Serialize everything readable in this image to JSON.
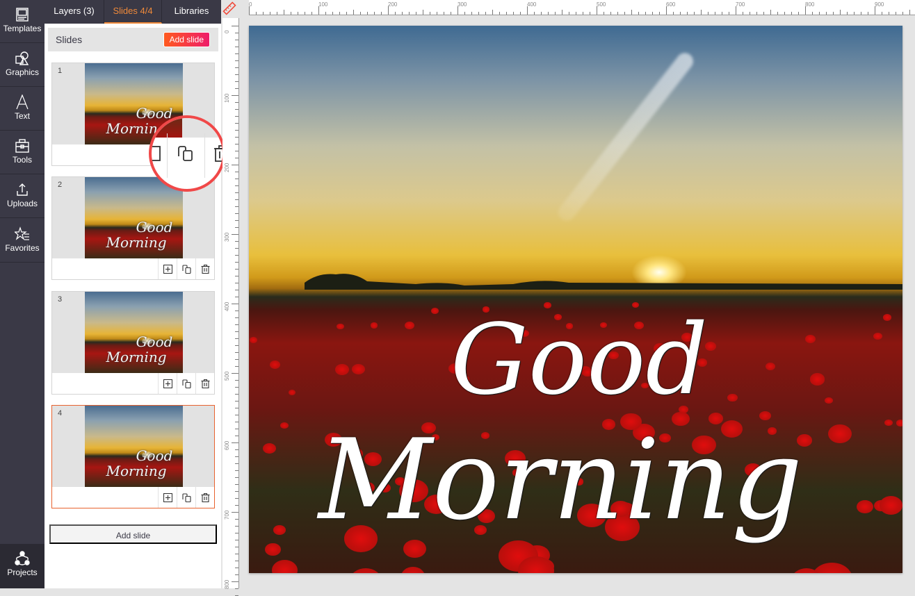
{
  "rail": {
    "items": [
      {
        "label": "Templates",
        "icon": "templates-icon"
      },
      {
        "label": "Graphics",
        "icon": "graphics-icon"
      },
      {
        "label": "Text",
        "icon": "text-icon"
      },
      {
        "label": "Tools",
        "icon": "toolbox-icon"
      },
      {
        "label": "Uploads",
        "icon": "upload-icon"
      },
      {
        "label": "Favorites",
        "icon": "favorites-icon"
      }
    ],
    "bottom": {
      "label": "Projects",
      "icon": "projects-icon"
    }
  },
  "tabs": [
    {
      "label": "Layers (3)"
    },
    {
      "label": "Slides 4/4",
      "active": true
    },
    {
      "label": "Libraries"
    }
  ],
  "slides_panel": {
    "title": "Slides",
    "add_button": "Add slide",
    "add_bottom": "Add slide",
    "slides": [
      {
        "number": "1",
        "thumb_line1": "Good",
        "thumb_line2": "Morning"
      },
      {
        "number": "2",
        "thumb_line1": "Good",
        "thumb_line2": "Morning"
      },
      {
        "number": "3",
        "thumb_line1": "Good",
        "thumb_line2": "Morning"
      },
      {
        "number": "4",
        "thumb_line1": "Good",
        "thumb_line2": "Morning",
        "active": true
      }
    ],
    "slide_actions": [
      "add-slide-icon",
      "duplicate-icon",
      "trash-icon"
    ]
  },
  "rulers": {
    "horizontal_labels": [
      "0",
      "100",
      "200",
      "300",
      "400",
      "500",
      "600",
      "700",
      "800",
      "900"
    ],
    "vertical_labels": [
      "0",
      "100",
      "200",
      "300",
      "400",
      "500",
      "600",
      "700",
      "800"
    ]
  },
  "canvas": {
    "line1": "Good",
    "line2": "Morning"
  },
  "colors": {
    "accent": "#f08a3a",
    "rail": "#3a3946",
    "add_button_start": "#ff5a1f",
    "add_button_end": "#ee1c6a",
    "active_border": "#e8622e",
    "callout": "#f04848"
  }
}
